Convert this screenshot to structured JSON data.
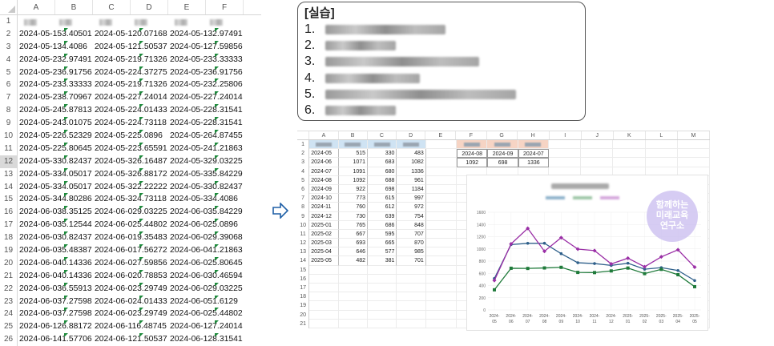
{
  "left_sheet": {
    "columns": [
      "A",
      "B",
      "C",
      "D",
      "E",
      "F"
    ],
    "rows": [
      {
        "n": "1",
        "a": "",
        "b": "",
        "c": ""
      },
      {
        "n": "2",
        "a": "2024-05-1",
        "an": "53.40501",
        "b": "2024-05-1",
        "bn": "20.07168",
        "c": "2024-05-1",
        "cn": "32.97491"
      },
      {
        "n": "3",
        "a": "2024-05-1",
        "an": "34.4086",
        "b": "2024-05-1",
        "bn": "21.50537",
        "c": "2024-05-1",
        "cn": "27.59856"
      },
      {
        "n": "4",
        "a": "2024-05-2",
        "an": "32.97491",
        "b": "2024-05-2",
        "bn": "19.71326",
        "c": "2024-05-2",
        "cn": "33.33333"
      },
      {
        "n": "5",
        "a": "2024-05-2",
        "an": "36.91756",
        "b": "2024-05-2",
        "bn": "24.37275",
        "c": "2024-05-2",
        "cn": "36.91756"
      },
      {
        "n": "6",
        "a": "2024-05-2",
        "an": "33.33333",
        "b": "2024-05-2",
        "bn": "19.71326",
        "c": "2024-05-2",
        "cn": "32.25806"
      },
      {
        "n": "7",
        "a": "2024-05-2",
        "an": "38.70967",
        "b": "2024-05-2",
        "bn": "27.24014",
        "c": "2024-05-2",
        "cn": "27.24014"
      },
      {
        "n": "8",
        "a": "2024-05-2",
        "an": "45.87813",
        "b": "2024-05-2",
        "bn": "24.01433",
        "c": "2024-05-2",
        "cn": "28.31541"
      },
      {
        "n": "9",
        "a": "2024-05-2",
        "an": "43.01075",
        "b": "2024-05-2",
        "bn": "24.73118",
        "c": "2024-05-2",
        "cn": "28.31541"
      },
      {
        "n": "10",
        "a": "2024-05-2",
        "an": "26.52329",
        "b": "2024-05-2",
        "bn": "25.0896",
        "c": "2024-05-2",
        "cn": "64.87455"
      },
      {
        "n": "11",
        "a": "2024-05-2",
        "an": "25.80645",
        "b": "2024-05-2",
        "bn": "23.65591",
        "c": "2024-05-2",
        "cn": "41.21863"
      },
      {
        "n": "12",
        "a": "2024-05-3",
        "an": "30.82437",
        "b": "2024-05-3",
        "bn": "26.16487",
        "c": "2024-05-3",
        "cn": "29.03225",
        "selected": true
      },
      {
        "n": "13",
        "a": "2024-05-3",
        "an": "34.05017",
        "b": "2024-05-3",
        "bn": "26.88172",
        "c": "2024-05-3",
        "cn": "35.84229"
      },
      {
        "n": "14",
        "a": "2024-05-3",
        "an": "34.05017",
        "b": "2024-05-3",
        "bn": "22.22222",
        "c": "2024-05-3",
        "cn": "30.82437"
      },
      {
        "n": "15",
        "a": "2024-05-3",
        "an": "44.80286",
        "b": "2024-05-3",
        "bn": "24.73118",
        "c": "2024-05-3",
        "cn": "34.4086"
      },
      {
        "n": "16",
        "a": "2024-06-0",
        "an": "38.35125",
        "b": "2024-06-0",
        "bn": "29.03225",
        "c": "2024-06-0",
        "cn": "35.84229"
      },
      {
        "n": "17",
        "a": "2024-06-0",
        "an": "35.12544",
        "b": "2024-06-0",
        "bn": "25.44802",
        "c": "2024-06-0",
        "cn": "25.0896"
      },
      {
        "n": "18",
        "a": "2024-06-0",
        "an": "30.82437",
        "b": "2024-06-0",
        "bn": "19.35483",
        "c": "2024-06-0",
        "cn": "29.39068"
      },
      {
        "n": "19",
        "a": "2024-06-0",
        "an": "35.48387",
        "b": "2024-06-0",
        "bn": "17.56272",
        "c": "2024-06-0",
        "cn": "41.21863"
      },
      {
        "n": "20",
        "a": "2024-06-0",
        "an": "40.14336",
        "b": "2024-06-0",
        "bn": "27.59856",
        "c": "2024-06-0",
        "cn": "25.80645"
      },
      {
        "n": "21",
        "a": "2024-06-0",
        "an": "40.14336",
        "b": "2024-06-0",
        "bn": "20.78853",
        "c": "2024-06-0",
        "cn": "30.46594"
      },
      {
        "n": "22",
        "a": "2024-06-0",
        "an": "36.55913",
        "b": "2024-06-0",
        "bn": "23.29749",
        "c": "2024-06-0",
        "cn": "29.03225"
      },
      {
        "n": "23",
        "a": "2024-06-0",
        "an": "37.27598",
        "b": "2024-06-0",
        "bn": "24.01433",
        "c": "2024-06-0",
        "cn": "51.6129"
      },
      {
        "n": "24",
        "a": "2024-06-0",
        "an": "37.27598",
        "b": "2024-06-0",
        "bn": "23.29749",
        "c": "2024-06-0",
        "cn": "25.44802"
      },
      {
        "n": "25",
        "a": "2024-06-1",
        "an": "26.88172",
        "b": "2024-06-1",
        "bn": "16.48745",
        "c": "2024-06-1",
        "cn": "27.24014"
      },
      {
        "n": "26",
        "a": "2024-06-1",
        "an": "41.57706",
        "b": "2024-06-1",
        "bn": "21.50537",
        "c": "2024-06-1",
        "cn": "28.31541"
      }
    ]
  },
  "task_box": {
    "title": "[실습]",
    "items": [
      "1.",
      "2.",
      "3.",
      "4.",
      "5.",
      "6."
    ]
  },
  "right_sheet": {
    "columns": [
      "A",
      "B",
      "C",
      "D",
      "E",
      "F",
      "G",
      "H",
      "I",
      "J",
      "K",
      "L",
      "M"
    ],
    "row_numbers": [
      "1",
      "2",
      "3",
      "4",
      "5",
      "6",
      "7",
      "8",
      "9",
      "10",
      "11",
      "12",
      "13",
      "14",
      "15",
      "16",
      "17",
      "18",
      "19",
      "20",
      "21"
    ],
    "table": [
      [
        "2024-05",
        "515",
        "330",
        "483"
      ],
      [
        "2024-06",
        "1071",
        "683",
        "1082"
      ],
      [
        "2024-07",
        "1091",
        "680",
        "1336"
      ],
      [
        "2024-08",
        "1092",
        "688",
        "961"
      ],
      [
        "2024-09",
        "922",
        "698",
        "1184"
      ],
      [
        "2024-10",
        "773",
        "615",
        "997"
      ],
      [
        "2024-11",
        "760",
        "612",
        "972"
      ],
      [
        "2024-12",
        "730",
        "639",
        "754"
      ],
      [
        "2025-01",
        "765",
        "686",
        "848"
      ],
      [
        "2025-02",
        "667",
        "595",
        "707"
      ],
      [
        "2025-03",
        "693",
        "665",
        "870"
      ],
      [
        "2025-04",
        "646",
        "577",
        "985"
      ],
      [
        "2025-05",
        "482",
        "381",
        "701"
      ]
    ],
    "summary_headers": [
      "2024-08",
      "2024-09",
      "2024-07"
    ],
    "summary_values": [
      "1092",
      "698",
      "1336"
    ]
  },
  "watermark": {
    "line1": "함께하는",
    "line2": "미래교육",
    "line3": "연구소"
  },
  "chart_data": {
    "type": "line",
    "categories": [
      "2024-05",
      "2024-06",
      "2024-07",
      "2024-08",
      "2024-09",
      "2024-10",
      "2024-11",
      "2024-12",
      "2025-01",
      "2025-02",
      "2025-03",
      "2025-04",
      "2025-05"
    ],
    "series": [
      {
        "values": [
          515,
          1071,
          1091,
          1092,
          922,
          773,
          760,
          730,
          765,
          667,
          693,
          646,
          482
        ],
        "color": "#2e5f8a"
      },
      {
        "values": [
          330,
          683,
          680,
          688,
          698,
          615,
          612,
          639,
          686,
          595,
          665,
          577,
          381
        ],
        "color": "#1f7a3a"
      },
      {
        "values": [
          483,
          1082,
          1336,
          961,
          1184,
          997,
          972,
          754,
          848,
          707,
          870,
          985,
          701
        ],
        "color": "#9a2fa6"
      }
    ],
    "yticks": [
      "0",
      "200",
      "400",
      "600",
      "800",
      "1000",
      "1200",
      "1400",
      "1600"
    ],
    "ylim": [
      0,
      1600
    ],
    "grid": true
  },
  "colors": {
    "accent_blue": "#cfe3f3",
    "accent_peach": "#f6d4c4",
    "arrow": "#1f5fa6"
  }
}
